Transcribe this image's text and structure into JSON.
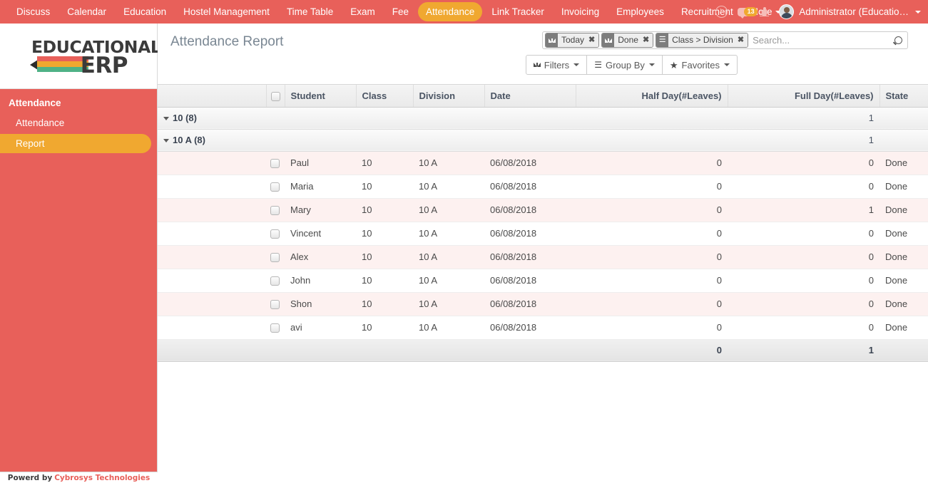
{
  "topbar": {
    "menu": [
      {
        "label": "Discuss",
        "active": false
      },
      {
        "label": "Calendar",
        "active": false
      },
      {
        "label": "Education",
        "active": false
      },
      {
        "label": "Hostel Management",
        "active": false
      },
      {
        "label": "Time Table",
        "active": false
      },
      {
        "label": "Exam",
        "active": false
      },
      {
        "label": "Fee",
        "active": false
      },
      {
        "label": "Attendance",
        "active": true
      },
      {
        "label": "Link Tracker",
        "active": false
      },
      {
        "label": "Invoicing",
        "active": false
      },
      {
        "label": "Employees",
        "active": false
      },
      {
        "label": "Recruitment",
        "active": false
      }
    ],
    "more_label": "More",
    "message_count": "13",
    "user_label": "Administrator (Educatio…",
    "icons": {
      "clock": "clock-icon",
      "messages": "messages-icon",
      "debug": "bug-icon",
      "avatar": "avatar-icon"
    },
    "colors": {
      "bar": "#E8605A",
      "active_pill": "#F0A830"
    }
  },
  "sidebar": {
    "logo": {
      "line1": "EDUCATIONAL",
      "line2": "ERP"
    },
    "section_title": "Attendance",
    "items": [
      {
        "label": "Attendance",
        "active": false
      },
      {
        "label": "Report",
        "active": true
      }
    ],
    "footer": {
      "prefix": "Powerd by",
      "brand": "Cybrosys Technologies"
    },
    "colors": {
      "background": "#E8605A",
      "active": "#F0A830",
      "brand": "#E8605A"
    }
  },
  "control_panel": {
    "title": "Attendance Report",
    "search": {
      "placeholder": "Search...",
      "value": "",
      "facets": [
        {
          "label": "Today",
          "icon": "filter-icon"
        },
        {
          "label": "Done",
          "icon": "filter-icon"
        },
        {
          "label": "Class > Division",
          "icon": "group-by-icon"
        }
      ]
    },
    "buttons": [
      {
        "label": "Filters",
        "icon": "filter-icon"
      },
      {
        "label": "Group By",
        "icon": "bars-icon"
      },
      {
        "label": "Favorites",
        "icon": "star-icon"
      }
    ]
  },
  "table": {
    "columns": [
      {
        "label": "",
        "key": "group",
        "align": "left"
      },
      {
        "label": "",
        "key": "check",
        "align": "left"
      },
      {
        "label": "Student",
        "key": "student",
        "align": "left"
      },
      {
        "label": "Class",
        "key": "class",
        "align": "left"
      },
      {
        "label": "Division",
        "key": "division",
        "align": "left"
      },
      {
        "label": "Date",
        "key": "date",
        "align": "left"
      },
      {
        "label": "Half Day(#Leaves)",
        "key": "half_day",
        "align": "right"
      },
      {
        "label": "Full Day(#Leaves)",
        "key": "full_day",
        "align": "right"
      },
      {
        "label": "State",
        "key": "state",
        "align": "left"
      }
    ],
    "groups": [
      {
        "label": "10 (8)",
        "level": 0,
        "half_day": "",
        "full_day": "1"
      },
      {
        "label": "10 A (8)",
        "level": 1,
        "half_day": "",
        "full_day": "1"
      }
    ],
    "rows": [
      {
        "student": "Paul",
        "class": "10",
        "division": "10 A",
        "date": "06/08/2018",
        "half_day": "0",
        "full_day": "0",
        "state": "Done"
      },
      {
        "student": "Maria",
        "class": "10",
        "division": "10 A",
        "date": "06/08/2018",
        "half_day": "0",
        "full_day": "0",
        "state": "Done"
      },
      {
        "student": "Mary",
        "class": "10",
        "division": "10 A",
        "date": "06/08/2018",
        "half_day": "0",
        "full_day": "1",
        "state": "Done"
      },
      {
        "student": "Vincent",
        "class": "10",
        "division": "10 A",
        "date": "06/08/2018",
        "half_day": "0",
        "full_day": "0",
        "state": "Done"
      },
      {
        "student": "Alex",
        "class": "10",
        "division": "10 A",
        "date": "06/08/2018",
        "half_day": "0",
        "full_day": "0",
        "state": "Done"
      },
      {
        "student": "John",
        "class": "10",
        "division": "10 A",
        "date": "06/08/2018",
        "half_day": "0",
        "full_day": "0",
        "state": "Done"
      },
      {
        "student": "Shon",
        "class": "10",
        "division": "10 A",
        "date": "06/08/2018",
        "half_day": "0",
        "full_day": "0",
        "state": "Done"
      },
      {
        "student": "avi",
        "class": "10",
        "division": "10 A",
        "date": "06/08/2018",
        "half_day": "0",
        "full_day": "0",
        "state": "Done"
      }
    ],
    "totals": {
      "half_day": "0",
      "full_day": "1"
    }
  }
}
